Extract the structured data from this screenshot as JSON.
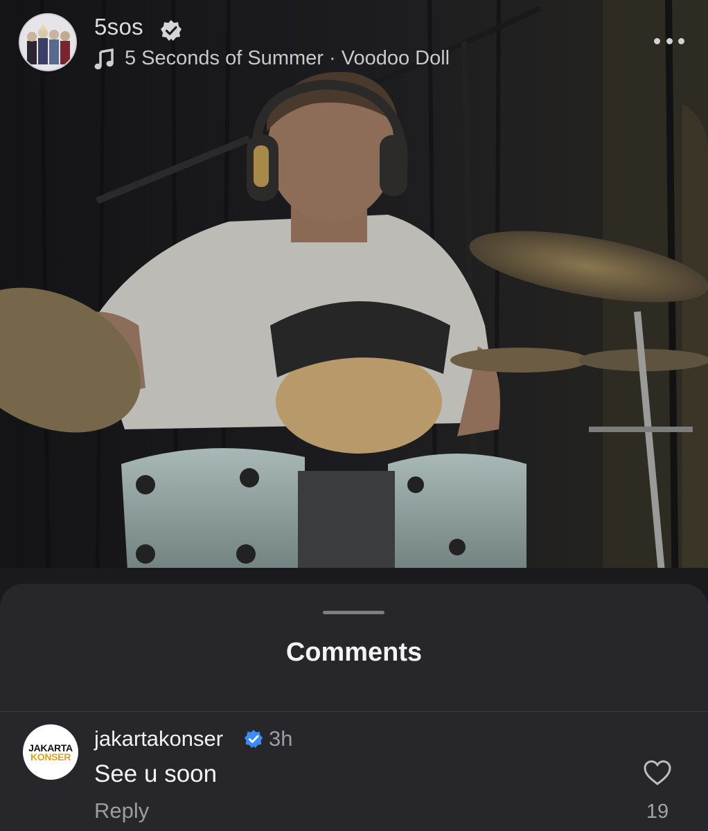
{
  "post": {
    "username": "5sos",
    "verified": true,
    "music": {
      "artist": "5 Seconds of Summer",
      "separator": " · ",
      "song": "Voodoo Doll"
    }
  },
  "comments_sheet": {
    "title": "Comments",
    "comments": [
      {
        "username": "jakartakonser",
        "verified": true,
        "time": "3h",
        "text": "See u soon",
        "reply_label": "Reply",
        "like_count": "19",
        "avatar_logo": [
          "JAKARTA",
          "KONSER"
        ]
      }
    ]
  },
  "colors": {
    "verified_badge": "#3b8cf6",
    "sheet_background": "#26262b",
    "logo_accent": "#d8a21c"
  },
  "icons": [
    "verified-icon",
    "music-note-icon",
    "more-icon",
    "heart-icon"
  ]
}
